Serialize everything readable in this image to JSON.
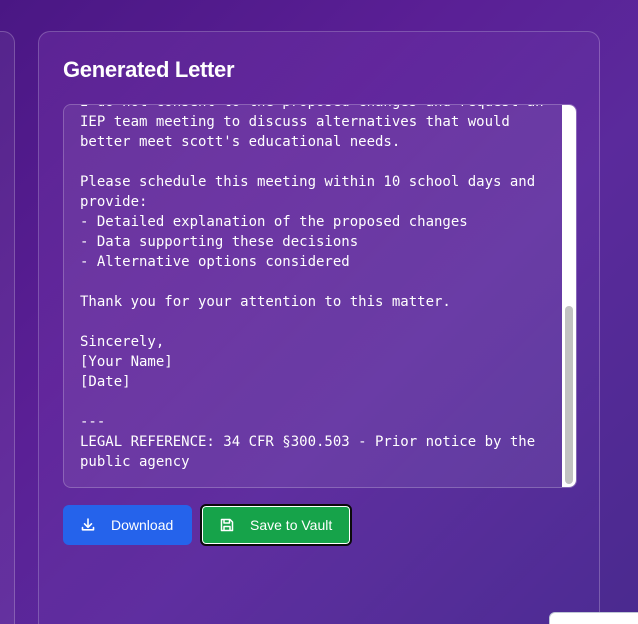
{
  "card": {
    "title": "Generated Letter"
  },
  "letter": {
    "text": "I do not consent to the proposed changes and request an\nIEP team meeting to discuss alternatives that would\nbetter meet scott's educational needs.\n\nPlease schedule this meeting within 10 school days and\nprovide:\n- Detailed explanation of the proposed changes\n- Data supporting these decisions\n- Alternative options considered\n\nThank you for your attention to this matter.\n\nSincerely,\n[Your Name]\n[Date]\n\n---\nLEGAL REFERENCE: 34 CFR §300.503 - Prior notice by the\npublic agency"
  },
  "actions": {
    "download_label": "Download",
    "save_label": "Save to Vault",
    "download_icon": "download-icon",
    "save_icon": "floppy-disk-icon"
  },
  "colors": {
    "download_button": "#2563eb",
    "save_button": "#16a34a"
  }
}
